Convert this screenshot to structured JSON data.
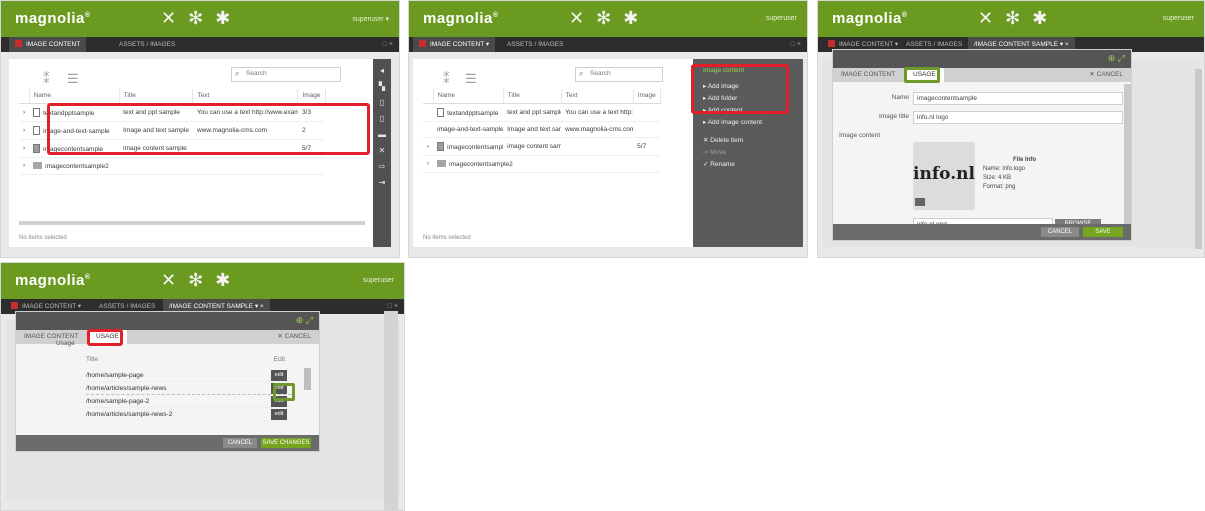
{
  "app": {
    "logo": "magnolia",
    "logo_mark": "®",
    "icons": [
      "apps-icon",
      "favorites-icon",
      "pulse-icon"
    ],
    "user_short": "superuser",
    "user_menu": "superuser ▾"
  },
  "tabs": {
    "image_content": "IMAGE CONTENT",
    "image_content_caret": "IMAGE CONTENT ▾",
    "assets_second": "ASSETS / IMAGES",
    "detail_tab": "/IMAGE CONTENT SAMPLE ▾",
    "close": "×",
    "window_controls": "□  ×"
  },
  "panel1": {
    "search_placeholder": "Search",
    "columns": [
      "Name",
      "Title",
      "Text",
      "Image"
    ],
    "rows": [
      {
        "name": "textandpptsample",
        "title": "text and ppt sample",
        "text": "You can use a text http://www.example.de",
        "image": "3/3",
        "icon": "file"
      },
      {
        "name": "image-and-text-sample",
        "title": "Image and text sample",
        "text": "www.magnolia-cms.com",
        "image": "2",
        "icon": "file"
      },
      {
        "name": "imagecontentsample",
        "title": "image content sample",
        "text": "",
        "image": "5/7",
        "icon": "image"
      },
      {
        "name": "imagecontentsample2",
        "title": "",
        "text": "",
        "image": "",
        "icon": "folder"
      }
    ],
    "status": "No items selected",
    "actions": [
      "◂",
      "▚",
      "▯",
      "▯",
      "▬",
      "✕",
      "⇨",
      "⇥"
    ]
  },
  "panel2": {
    "search_placeholder": "Search",
    "columns": [
      "Name",
      "Title",
      "Text",
      "Image"
    ],
    "rows": [
      {
        "name": "textandpptsample",
        "title": "text and ppt sample",
        "text": "You can use a text http://www.example.de",
        "image": "",
        "icon": "file"
      },
      {
        "name": "image-and-text-sample",
        "title": "Image and text sample",
        "text": "www.magnolia-cms.com",
        "image": "",
        "icon": "file"
      },
      {
        "name": "imagecontentsample",
        "title": "image content sample",
        "text": "",
        "image": "5/7",
        "icon": "image"
      },
      {
        "name": "imagecontentsample2",
        "title": "",
        "text": "",
        "image": "",
        "icon": "folder"
      }
    ],
    "status": "No items selected",
    "action_title": "Image content",
    "action_items": [
      "Add image",
      "Add folder",
      "Add content",
      "Add image content"
    ],
    "action_items_dim": [
      "Delete item",
      "Move",
      "Rename"
    ]
  },
  "panel3": {
    "tab_content": "IMAGE CONTENT",
    "tab_usage": "USAGE",
    "cancel": "✕ CANCEL",
    "field1_label": "Name",
    "field1_value": "imagecontentsample",
    "field2_label": "Image title",
    "field2_value": "info.nl logo",
    "field3_label": "Image content",
    "preview_text": "info.nl",
    "file_info_title": "File Info",
    "file_info_lines": [
      "Name: info.logo",
      "Size: 4 KB",
      "Format: png"
    ],
    "upload_field": "info.nl.png",
    "upload_button": "BROWSE",
    "btn_cancel": "CANCEL",
    "btn_save": "SAVE"
  },
  "panel4": {
    "tab_content": "IMAGE CONTENT",
    "tab_usage": "USAGE",
    "cancel": "✕ CANCEL",
    "field_label": "Usage",
    "col_name": "Title",
    "col_edit": "Edit",
    "rows": [
      {
        "title": "/home/sample-page",
        "button": "edit",
        "sep": false
      },
      {
        "title": "/home/articles/sample-news",
        "button": "edit",
        "sep": true
      },
      {
        "title": "/home/sample-page-2",
        "button": "edit",
        "sep": false
      },
      {
        "title": "/home/articles/sample-news-2",
        "button": "edit",
        "sep": false
      }
    ],
    "btn_cancel": "CANCEL",
    "btn_save": "SAVE CHANGES"
  },
  "colors": {
    "brand_green": "#6a9a20",
    "highlight_red": "#e3202a",
    "highlight_green": "#6f9a2a"
  }
}
